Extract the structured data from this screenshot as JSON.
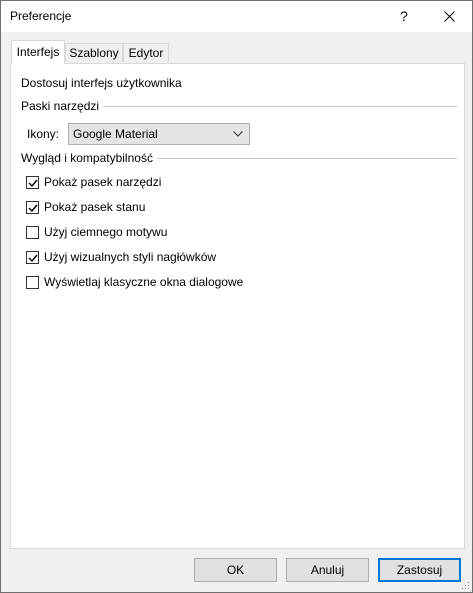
{
  "window": {
    "title": "Preferencje",
    "help_glyph": "?"
  },
  "tabs": [
    {
      "label": "Interfejs",
      "active": true
    },
    {
      "label": "Szablony",
      "active": false
    },
    {
      "label": "Edytor",
      "active": false
    }
  ],
  "panel": {
    "heading": "Dostosuj interfejs użytkownika",
    "toolbars_group": {
      "label": "Paski narzędzi",
      "icons_label": "Ikony:",
      "icons_value": "Google Material"
    },
    "appearance_group": {
      "label": "Wygląd i kompatybilność",
      "options": [
        {
          "label": "Pokaż pasek narzędzi",
          "checked": true
        },
        {
          "label": "Pokaż pasek stanu",
          "checked": true
        },
        {
          "label": "Użyj ciemnego motywu",
          "checked": false
        },
        {
          "label": "Użyj wizualnych styli nagłówków",
          "checked": true
        },
        {
          "label": "Wyświetlaj klasyczne okna dialogowe",
          "checked": false
        }
      ]
    }
  },
  "buttons": {
    "ok": "OK",
    "cancel": "Anuluj",
    "apply": "Zastosuj"
  },
  "colors": {
    "accent": "#0078d7",
    "dialog_bg": "#f0f0f0",
    "panel_bg": "#ffffff"
  }
}
